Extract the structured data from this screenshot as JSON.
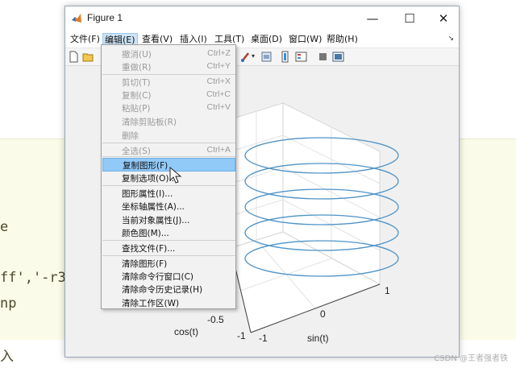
{
  "editor": {
    "code_line_1": "e",
    "code_line_2": "ff','-r3",
    "code_line_3": "np",
    "code_line_4": "入"
  },
  "watermark": "CSDN @王者强者铁",
  "window": {
    "title": "Figure 1",
    "minimize": "—",
    "maximize": "☐",
    "close": "✕"
  },
  "menubar": {
    "items": [
      {
        "label": "文件(F)"
      },
      {
        "label": "编辑(E)"
      },
      {
        "label": "查看(V)"
      },
      {
        "label": "插入(I)"
      },
      {
        "label": "工具(T)"
      },
      {
        "label": "桌面(D)"
      },
      {
        "label": "窗口(W)"
      },
      {
        "label": "帮助(H)"
      }
    ],
    "active_index": 1,
    "dock_glyph": "↘"
  },
  "edit_menu": {
    "items": [
      {
        "label": "撤消(U)",
        "shortcut": "Ctrl+Z",
        "enabled": false
      },
      {
        "label": "重做(R)",
        "shortcut": "Ctrl+Y",
        "enabled": false
      },
      {
        "label": "剪切(T)",
        "shortcut": "Ctrl+X",
        "enabled": false
      },
      {
        "label": "复制(C)",
        "shortcut": "Ctrl+C",
        "enabled": false
      },
      {
        "label": "粘贴(P)",
        "shortcut": "Ctrl+V",
        "enabled": false
      },
      {
        "label": "清除剪贴板(R)",
        "shortcut": "",
        "enabled": false
      },
      {
        "label": "删除",
        "shortcut": "",
        "enabled": false
      },
      {
        "label": "全选(S)",
        "shortcut": "Ctrl+A",
        "enabled": false
      },
      {
        "label": "复制图形(F)",
        "shortcut": "",
        "enabled": true,
        "highlighted": true
      },
      {
        "label": "复制选项(O)...",
        "shortcut": "",
        "enabled": true
      },
      {
        "label": "图形属性(I)...",
        "shortcut": "",
        "enabled": true
      },
      {
        "label": "坐标轴属性(A)...",
        "shortcut": "",
        "enabled": true
      },
      {
        "label": "当前对象属性(J)...",
        "shortcut": "",
        "enabled": true
      },
      {
        "label": "颜色图(M)...",
        "shortcut": "",
        "enabled": true
      },
      {
        "label": "查找文件(F)...",
        "shortcut": "",
        "enabled": true
      },
      {
        "label": "清除图形(F)",
        "shortcut": "",
        "enabled": true
      },
      {
        "label": "清除命令行窗口(C)",
        "shortcut": "",
        "enabled": true
      },
      {
        "label": "清除命令历史记录(H)",
        "shortcut": "",
        "enabled": true
      },
      {
        "label": "清除工作区(W)",
        "shortcut": "",
        "enabled": true
      }
    ]
  },
  "axes": {
    "xlabel": "cos(t)",
    "ylabel": "sin(t)",
    "xticks": [
      "-1",
      "-0.5"
    ],
    "yticks": [
      "-1",
      "0",
      "1"
    ],
    "line_color": "#4f93c7"
  },
  "colors": {
    "menu_highlight": "#91c9f7",
    "menubar_active": "#cce4f7",
    "editor_band": "#fbfbe9"
  }
}
